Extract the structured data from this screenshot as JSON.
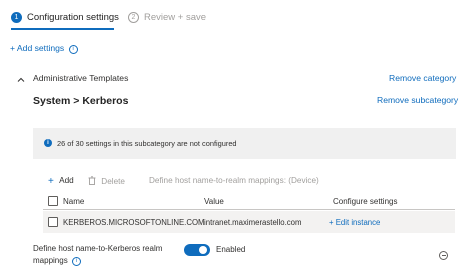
{
  "wizard": {
    "steps": [
      {
        "number": "1",
        "label": "Configuration settings",
        "state": "active"
      },
      {
        "number": "2",
        "label": "Review + save",
        "state": "inactive"
      }
    ]
  },
  "add_settings": {
    "label": "+ Add settings",
    "info_icon": "info-icon"
  },
  "section": {
    "title": "Administrative Templates",
    "remove_category_label": "Remove category",
    "subcategory_heading": "System > Kerberos",
    "remove_subcategory_label": "Remove subcategory"
  },
  "banner": {
    "icon": "info-icon",
    "text": "26 of 30 settings in this subcategory are not configured"
  },
  "toolbar": {
    "add_label": "Add",
    "delete_label": "Delete",
    "context_text": "Define host name-to-realm mappings: (Device)"
  },
  "table": {
    "columns": [
      "Name",
      "Value",
      "Configure settings"
    ],
    "rows": [
      {
        "name": "KERBEROS.MICROSOFTONLINE.COM",
        "value": "intranet.maximerastello.com",
        "action": "+ Edit instance"
      }
    ]
  },
  "setting": {
    "label_line1": "Define host name-to-Kerberos realm",
    "label_line2": "mappings",
    "info_icon": "info-icon",
    "toggle_state": "Enabled",
    "remove_icon": "minus-circle-icon"
  },
  "colors": {
    "accent": "#0f6cbd",
    "banner_bg": "#f0f0f0",
    "row_bg": "#f3f2f1",
    "muted_text": "#a19f9d"
  }
}
